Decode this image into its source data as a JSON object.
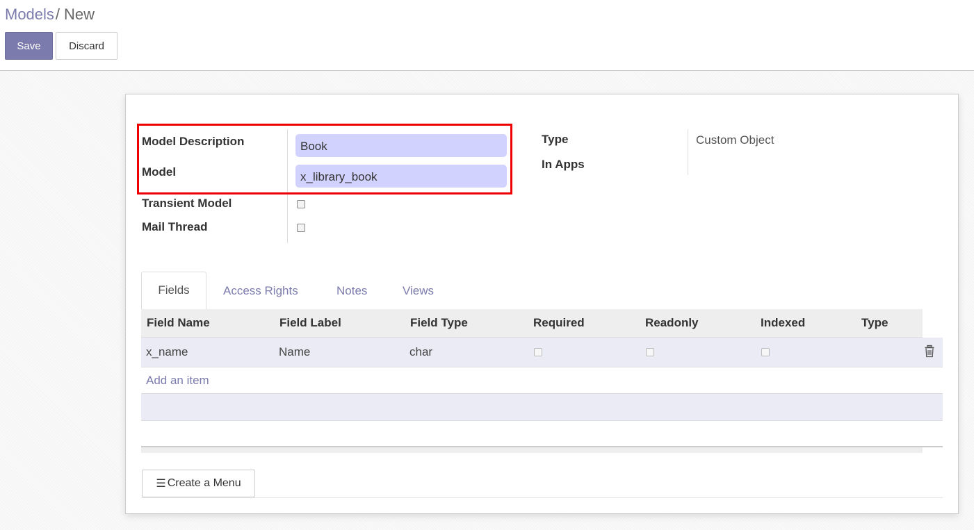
{
  "breadcrumb": {
    "parent": "Models",
    "separator": "/",
    "current": "New"
  },
  "toolbar": {
    "save_label": "Save",
    "discard_label": "Discard"
  },
  "form": {
    "model_description": {
      "label": "Model Description",
      "value": "Book"
    },
    "model": {
      "label": "Model",
      "value": "x_library_book"
    },
    "transient_model": {
      "label": "Transient Model",
      "checked": false
    },
    "mail_thread": {
      "label": "Mail Thread",
      "checked": false
    },
    "type": {
      "label": "Type",
      "value": "Custom Object"
    },
    "in_apps": {
      "label": "In Apps",
      "value": ""
    }
  },
  "tabs": [
    {
      "label": "Fields",
      "active": true
    },
    {
      "label": "Access Rights",
      "active": false
    },
    {
      "label": "Notes",
      "active": false
    },
    {
      "label": "Views",
      "active": false
    }
  ],
  "fields_table": {
    "columns": [
      "Field Name",
      "Field Label",
      "Field Type",
      "Required",
      "Readonly",
      "Indexed",
      "Type"
    ],
    "rows": [
      {
        "field_name": "x_name",
        "field_label": "Name",
        "field_type": "char",
        "required": false,
        "readonly": false,
        "indexed": false,
        "type": ""
      }
    ],
    "add_item_label": "Add an item"
  },
  "create_menu_label": "Create a Menu",
  "colors": {
    "accent": "#7c7bad",
    "input_bg": "#d2d2ff",
    "highlight_border": "#ee0000",
    "row_bg": "#ebebf5"
  },
  "icons": {
    "trash": "trash-icon",
    "menu": "menu-icon"
  }
}
